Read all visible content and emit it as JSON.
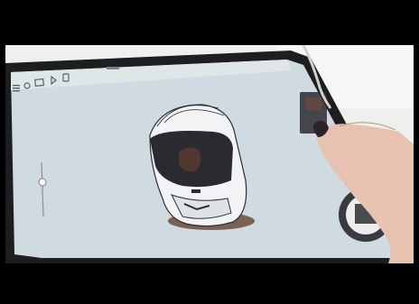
{
  "scene": {
    "subject": "tablet-sketching-app",
    "colors": {
      "letterbox": "#000000",
      "screen": "#cfdbe0",
      "tablet_bezel": "#1d1e20",
      "table": "#e9ece9",
      "skin": "#e7c2b0",
      "nail_polish": "#2b2325",
      "helmet_shell": "#f2f3f4",
      "visor": "#2a2b30",
      "shadow": "#6b4a3c"
    },
    "icons": [
      "menu-icon",
      "brush-icon",
      "layers-icon",
      "selection-icon",
      "transform-icon",
      "color-puck-icon",
      "size-slider-icon"
    ]
  }
}
